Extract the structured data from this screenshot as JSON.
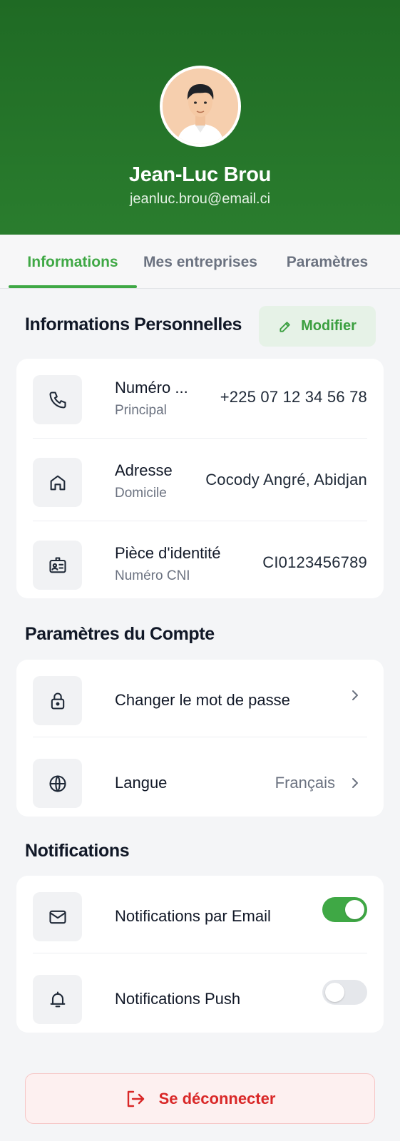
{
  "profile": {
    "name": "Jean-Luc Brou",
    "email": "jeanluc.brou@email.ci",
    "avatar_icon": "avatar-illustration"
  },
  "tabs": [
    {
      "label": "Informations",
      "active": true
    },
    {
      "label": "Mes entreprises",
      "active": false
    },
    {
      "label": "Paramètres",
      "active": false
    }
  ],
  "personal": {
    "title": "Informations Personnelles",
    "edit_label": "Modifier",
    "items": [
      {
        "icon": "phone-icon",
        "label": "Numéro ...",
        "sublabel": "Principal",
        "value": "+225 07 12 34 56 78"
      },
      {
        "icon": "home-icon",
        "label": "Adresse",
        "sublabel": "Domicile",
        "value": "Cocody Angré, Abidjan"
      },
      {
        "icon": "id-card-icon",
        "label": "Pièce d'identité",
        "sublabel": "Numéro CNI",
        "value": "CI0123456789"
      }
    ]
  },
  "account": {
    "title": "Paramètres du Compte",
    "items": [
      {
        "icon": "lock-icon",
        "label": "Changer le mot de passe",
        "value": ""
      },
      {
        "icon": "globe-icon",
        "label": "Langue",
        "value": "Français"
      }
    ]
  },
  "notifications": {
    "title": "Notifications",
    "items": [
      {
        "icon": "mail-icon",
        "label": "Notifications par Email",
        "enabled": true
      },
      {
        "icon": "bell-icon",
        "label": "Notifications Push",
        "enabled": false
      }
    ]
  },
  "logout_label": "Se déconnecter",
  "colors": {
    "header_green": "#1f6a24",
    "accent_green": "#3fa845",
    "danger_red": "#d92828",
    "background": "#f4f5f7"
  }
}
